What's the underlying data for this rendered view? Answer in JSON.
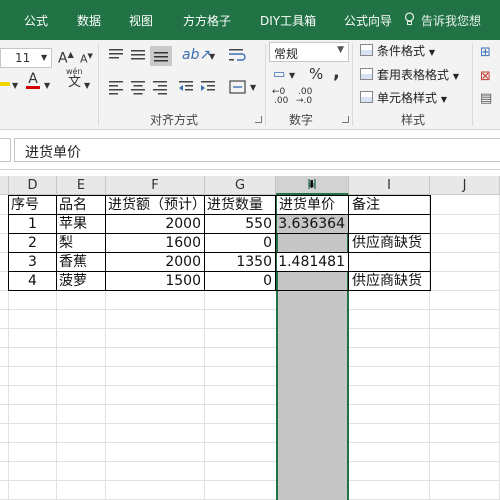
{
  "ribbon_tabs": [
    "公式",
    "数据",
    "视图",
    "方方格子",
    "DIY工具箱",
    "公式向导"
  ],
  "tell_me": "告诉我您想",
  "ribbon": {
    "font_size": "11",
    "increase_font_label": "A",
    "decrease_font_label": "A",
    "font_color_label": "A",
    "phonetic_label": "wén",
    "phonetic_char": "文",
    "number_format_value": "常规",
    "percent_label": "%",
    "comma_label": ",",
    "increase_decimal_top": "←0",
    "increase_decimal_bottom": ".00",
    "decrease_decimal_top": ".00",
    "decrease_decimal_bottom": "→.0",
    "conditional_format": "条件格式",
    "table_format": "套用表格格式",
    "cell_styles": "单元格样式",
    "group_alignment": "对齐方式",
    "group_number": "数字",
    "group_styles": "样式",
    "accent_color": "#217346"
  },
  "formula_bar": {
    "value": "进货单价"
  },
  "columns": [
    "D",
    "E",
    "F",
    "G",
    "H",
    "I",
    "J"
  ],
  "selected_column": "H",
  "table": {
    "headers": [
      "序号",
      "品名",
      "进货额（预计）",
      "进货数量",
      "进货单价",
      "备注"
    ],
    "rows": [
      [
        "1",
        "苹果",
        "2000",
        "550",
        "3.636364",
        ""
      ],
      [
        "2",
        "梨",
        "1600",
        "0",
        "",
        "供应商缺货"
      ],
      [
        "3",
        "香蕉",
        "2000",
        "1350",
        "1.481481",
        ""
      ],
      [
        "4",
        "菠萝",
        "1500",
        "0",
        "",
        "供应商缺货"
      ]
    ]
  }
}
